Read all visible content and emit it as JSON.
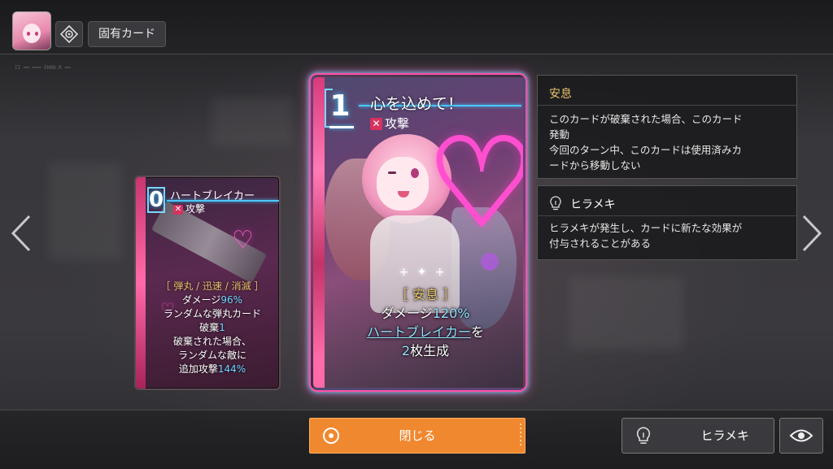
{
  "header": {
    "tab_label": "固有カード",
    "deco_text": "II ━━ ━━━ EHRN.R ━━"
  },
  "side_card": {
    "cost": "0",
    "title": "ハートブレイカー",
    "type": "攻撃",
    "type_icon": "crossed-swords-icon",
    "keywords": "［ 弾丸 / 迅速 / 消滅 ］",
    "line1_prefix": "ダメージ",
    "line1_value": "96%",
    "line2": "ランダムな弾丸カード",
    "line3_prefix": "破棄",
    "line3_value": "1",
    "line4": "破棄された場合、",
    "line5": "ランダムな敵に",
    "line6_prefix": "追加攻撃",
    "line6_value": "144%"
  },
  "main_card": {
    "cost": "1",
    "title": "心を込めて！",
    "type": "攻撃",
    "type_icon": "crossed-swords-icon",
    "keyword": "［ 安息 ］",
    "line1_prefix": "ダメージ",
    "line1_value": "120%",
    "line2_link": "ハートブレイカー",
    "line2_suffix": "を",
    "line3_value": "2",
    "line3_suffix": "枚生成"
  },
  "info_panels": [
    {
      "title": "安息",
      "body": "このカードが破棄された場合、このカード\n発動\n今回のターン中、このカードは使用済みカ\nードから移動しない"
    },
    {
      "title": "ヒラメキ",
      "icon": "lightbulb-icon",
      "body": "ヒラメキが発生し、カードに新たな効果が\n付与されることがある"
    }
  ],
  "footer": {
    "close_label": "閉じる",
    "inspiration_label": "ヒラメキ",
    "eye_icon": "eye-icon"
  },
  "colors": {
    "accent_orange": "#f0882f",
    "keyword_gold": "#e6c26a",
    "value_cyan": "#8fe0ff",
    "card_glow_pink": "#ff4fa8"
  }
}
